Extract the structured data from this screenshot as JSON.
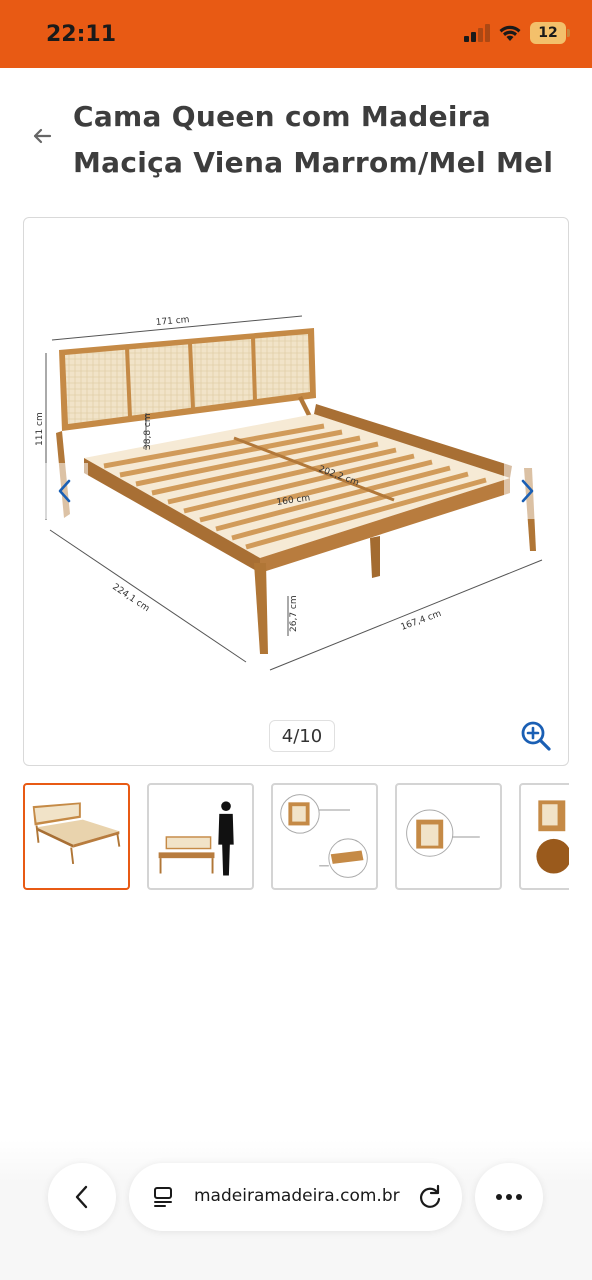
{
  "status_bar": {
    "time": "22:11",
    "battery": "12",
    "background": "#e85a14"
  },
  "header": {
    "back_icon": "arrow-left-icon",
    "title": "Cama Queen com Madeira Maciça Viena Marrom/Mel Mel"
  },
  "gallery": {
    "counter": "4/10",
    "dimensions": {
      "headboard_width": "171 cm",
      "total_height": "111 cm",
      "headboard_inner": "38,8 cm",
      "length": "202,2 cm",
      "mattress_width": "160 cm",
      "depth": "224,1 cm",
      "leg_height": "26,7 cm",
      "total_width": "167,4 cm"
    },
    "icons": {
      "prev": "chevron-left-icon",
      "next": "chevron-right-icon",
      "zoom": "zoom-in-icon"
    },
    "accent": "#1a5fb4"
  },
  "thumbnails": [
    {
      "label": "bed-dimensions",
      "active": true
    },
    {
      "label": "bed-with-person-scale",
      "active": false
    },
    {
      "label": "detail-wood-corners",
      "active": false
    },
    {
      "label": "detail-natural-finish",
      "active": false
    },
    {
      "label": "detail-wood-colors",
      "active": false
    }
  ],
  "browser": {
    "url": "madeiramadeira.com.br",
    "icons": [
      "chevron-left-icon",
      "tabs-icon",
      "reload-icon",
      "more-icon"
    ]
  }
}
